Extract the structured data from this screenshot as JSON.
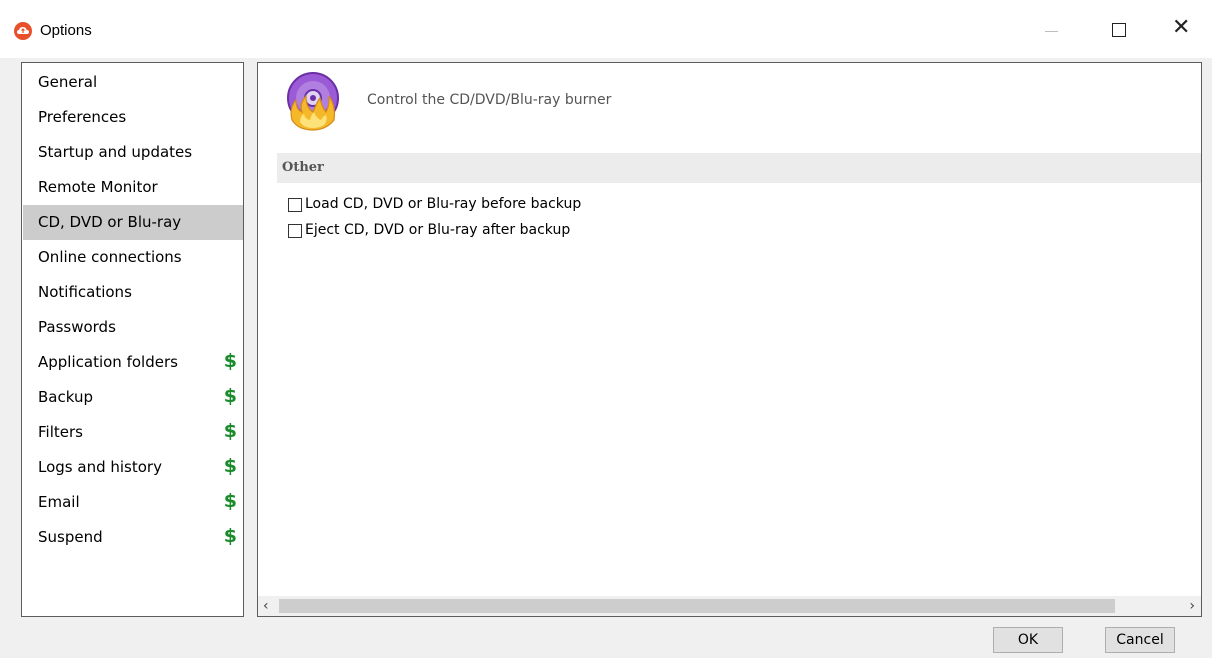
{
  "window": {
    "title": "Options",
    "icon": "cloud-app-icon",
    "controls": {
      "minimize": "minimize-icon",
      "maximize": "maximize-icon",
      "close": "close-icon"
    }
  },
  "sidebar": {
    "items": [
      {
        "label": "General",
        "paid": false,
        "selected": false
      },
      {
        "label": "Preferences",
        "paid": false,
        "selected": false
      },
      {
        "label": "Startup and updates",
        "paid": false,
        "selected": false
      },
      {
        "label": "Remote Monitor",
        "paid": false,
        "selected": false
      },
      {
        "label": "CD, DVD or Blu-ray",
        "paid": false,
        "selected": true
      },
      {
        "label": "Online connections",
        "paid": false,
        "selected": false
      },
      {
        "label": "Notifications",
        "paid": false,
        "selected": false
      },
      {
        "label": "Passwords",
        "paid": false,
        "selected": false
      },
      {
        "label": "Application folders",
        "paid": true,
        "selected": false
      },
      {
        "label": "Backup",
        "paid": true,
        "selected": false
      },
      {
        "label": "Filters",
        "paid": true,
        "selected": false
      },
      {
        "label": "Logs and history",
        "paid": true,
        "selected": false
      },
      {
        "label": "Email",
        "paid": true,
        "selected": false
      },
      {
        "label": "Suspend",
        "paid": true,
        "selected": false
      }
    ],
    "paid_symbol": "$",
    "paid_color": "#1a8a2a",
    "selected_color": "#cccccc"
  },
  "main": {
    "header_icon": "disc-burner-icon",
    "header_text": "Control the CD/DVD/Blu-ray burner",
    "section_title": "Other",
    "options": [
      {
        "label": "Load CD, DVD or Blu-ray before backup",
        "checked": false
      },
      {
        "label": "Eject CD, DVD or Blu-ray after backup",
        "checked": false
      }
    ],
    "scrollbar": {
      "left_arrow": "‹",
      "right_arrow": "›"
    }
  },
  "footer": {
    "ok_label": "OK",
    "cancel_label": "Cancel"
  }
}
